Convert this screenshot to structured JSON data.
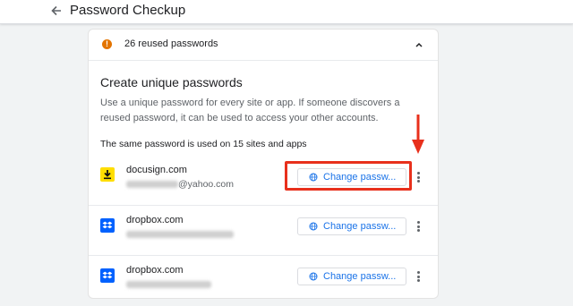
{
  "header": {
    "title": "Password Checkup"
  },
  "summary": {
    "text": "26 reused passwords",
    "warning_color": "#e37400"
  },
  "section": {
    "title": "Create unique passwords",
    "description": "Use a unique password for every site or app. If someone discovers a reused password, it can be used to access your other accounts.",
    "sites_caption": "The same password is used on 15 sites and apps"
  },
  "sites": [
    {
      "name": "docusign.com",
      "username_visible": "@yahoo.com",
      "button_label": "Change passw...",
      "icon": "docusign-icon",
      "icon_color": "#ffde00"
    },
    {
      "name": "dropbox.com",
      "username_visible": "",
      "button_label": "Change passw...",
      "icon": "dropbox-icon",
      "icon_color": "#0061fe"
    },
    {
      "name": "dropbox.com",
      "username_visible": "",
      "button_label": "Change passw...",
      "icon": "dropbox-icon",
      "icon_color": "#0061fe"
    }
  ],
  "colors": {
    "accent": "#1a73e8",
    "annotation": "#e8301c"
  }
}
